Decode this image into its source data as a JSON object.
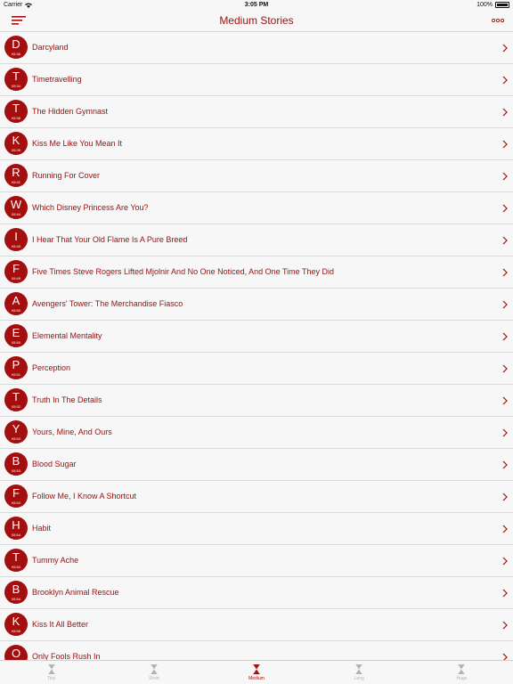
{
  "status": {
    "carrier": "Carrier",
    "time": "3:05 PM",
    "battery": "100%"
  },
  "nav": {
    "title": "Medium Stories"
  },
  "stories": [
    {
      "letter": "D",
      "time": "05:36",
      "title": "Darcyland"
    },
    {
      "letter": "T",
      "time": "05:34",
      "title": "Timetravelling"
    },
    {
      "letter": "T",
      "time": "05:38",
      "title": "The Hidden Gymnast"
    },
    {
      "letter": "K",
      "time": "05:39",
      "title": "Kiss Me Like You Mean It"
    },
    {
      "letter": "R",
      "time": "05:41",
      "title": "Running For Cover"
    },
    {
      "letter": "W",
      "time": "05:44",
      "title": "Which Disney Princess Are You?"
    },
    {
      "letter": "I",
      "time": "05:45",
      "title": "I Hear That Your Old Flame Is A Pure Breed"
    },
    {
      "letter": "F",
      "time": "05:49",
      "title": "Five Times Steve Rogers Lifted Mjolnir And No One Noticed, And One Time They Did"
    },
    {
      "letter": "A",
      "time": "05:50",
      "title": "Avengers' Tower: The Merchandise Fiasco"
    },
    {
      "letter": "E",
      "time": "05:50",
      "title": "Elemental Mentality"
    },
    {
      "letter": "P",
      "time": "05:51",
      "title": "Perception"
    },
    {
      "letter": "T",
      "time": "05:52",
      "title": "Truth In The Details"
    },
    {
      "letter": "Y",
      "time": "05:53",
      "title": "Yours, Mine, And Ours"
    },
    {
      "letter": "B",
      "time": "05:53",
      "title": "Blood Sugar"
    },
    {
      "letter": "F",
      "time": "05:53",
      "title": "Follow Me, I Know A Shortcut"
    },
    {
      "letter": "H",
      "time": "05:54",
      "title": "Habit"
    },
    {
      "letter": "T",
      "time": "05:54",
      "title": "Tummy Ache"
    },
    {
      "letter": "B",
      "time": "05:54",
      "title": "Brooklyn Animal Rescue"
    },
    {
      "letter": "K",
      "time": "05:56",
      "title": "Kiss It All Better"
    },
    {
      "letter": "O",
      "time": "05:57",
      "title": "Only Fools Rush In"
    }
  ],
  "tabs": [
    {
      "label": "Tiny",
      "icon": "hourglass-icon",
      "active": false
    },
    {
      "label": "Short",
      "icon": "hourglass-icon",
      "active": false
    },
    {
      "label": "Medium",
      "icon": "hourglass-icon",
      "active": true
    },
    {
      "label": "Long",
      "icon": "hourglass-icon",
      "active": false
    },
    {
      "label": "Huge",
      "icon": "hourglass-icon",
      "active": false
    }
  ],
  "colors": {
    "accent": "#a01010",
    "avatar": "#a30f0f",
    "inactive": "#b3b3b3"
  }
}
